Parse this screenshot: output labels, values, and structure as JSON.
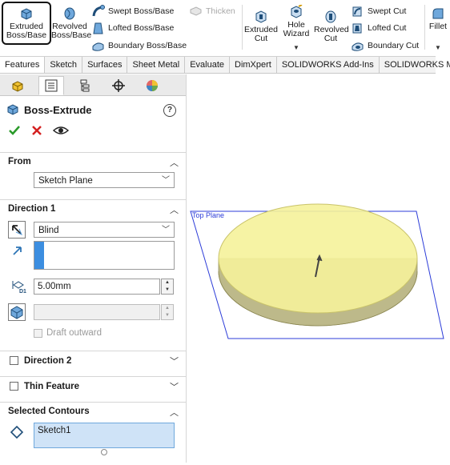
{
  "ribbon": {
    "extruded_boss": "Extruded\nBoss/Base",
    "revolved_boss": "Revolved\nBoss/Base",
    "swept_boss": "Swept Boss/Base",
    "lofted_boss": "Lofted Boss/Base",
    "boundary_boss": "Boundary Boss/Base",
    "thicken": "Thicken",
    "extruded_cut": "Extruded\nCut",
    "hole_wizard": "Hole\nWizard",
    "revolved_cut": "Revolved\nCut",
    "swept_cut": "Swept Cut",
    "lofted_cut": "Lofted Cut",
    "boundary_cut": "Boundary Cut",
    "fillet": "Fillet"
  },
  "tabs": [
    "Features",
    "Sketch",
    "Surfaces",
    "Sheet Metal",
    "Evaluate",
    "DimXpert",
    "SOLIDWORKS Add-Ins",
    "SOLIDWORKS MBD"
  ],
  "property_manager": {
    "title": "Boss-Extrude",
    "help": "?",
    "from": {
      "label": "From",
      "value": "Sketch Plane"
    },
    "direction1": {
      "label": "Direction 1",
      "end_condition": "Blind",
      "depth": "5.00mm",
      "depth_symbol": "D1",
      "draft_label": "Draft outward"
    },
    "direction2": {
      "label": "Direction 2"
    },
    "thin_feature": {
      "label": "Thin Feature"
    },
    "selected_contours": {
      "label": "Selected Contours",
      "item": "Sketch1"
    }
  },
  "viewport": {
    "plane_label": "Top Plane"
  },
  "colors": {
    "accent_blue": "#3c8ee0",
    "extrude_yellow": "#f5f29a",
    "plane_blue": "#2c3cd8",
    "confirm_green": "#2a9a2a",
    "cancel_red": "#d42020"
  }
}
